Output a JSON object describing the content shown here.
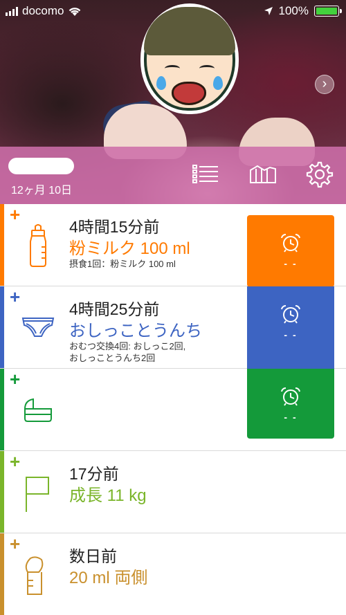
{
  "status_bar": {
    "carrier": "docomo",
    "battery": "100%"
  },
  "header": {
    "age": "12ヶ月 10日"
  },
  "colors": {
    "formula": "#ff7a00",
    "diaper": "#3d64c2",
    "sleep": "#149a3a",
    "growth": "#7ab52a",
    "pump": "#c9902d",
    "header_overlay": "#cd6eaa"
  },
  "icons": {
    "list": "list-icon",
    "growth_chart": "growth-chart-icon",
    "settings": "gear-icon",
    "formula": "baby-bottle-icon",
    "diaper": "diaper-icon",
    "sleep": "crib-icon",
    "growth": "flag-icon",
    "pump": "breast-pump-icon",
    "alarm": "alarm-clock-icon"
  },
  "rows": [
    {
      "ago": "4時間15分前",
      "main": "粉ミルク 100 ml",
      "detail_1": "摂食1回：粉ミルク 100 ml",
      "detail_2": "",
      "timer": "- -"
    },
    {
      "ago": "4時間25分前",
      "main": "おしっことうんち",
      "detail_1": "おむつ交換4回: おしっこ2回,",
      "detail_2": "おしっことうんち2回",
      "timer": "- -"
    },
    {
      "ago": "",
      "main": "",
      "detail_1": "",
      "detail_2": "",
      "timer": "- -"
    },
    {
      "ago": "17分前",
      "main": "成長 11 kg",
      "detail_1": "",
      "detail_2": ""
    },
    {
      "ago": "数日前",
      "main": "20 ml  両側",
      "detail_1": "",
      "detail_2": ""
    }
  ],
  "plus_label": "+",
  "next_label": "›"
}
